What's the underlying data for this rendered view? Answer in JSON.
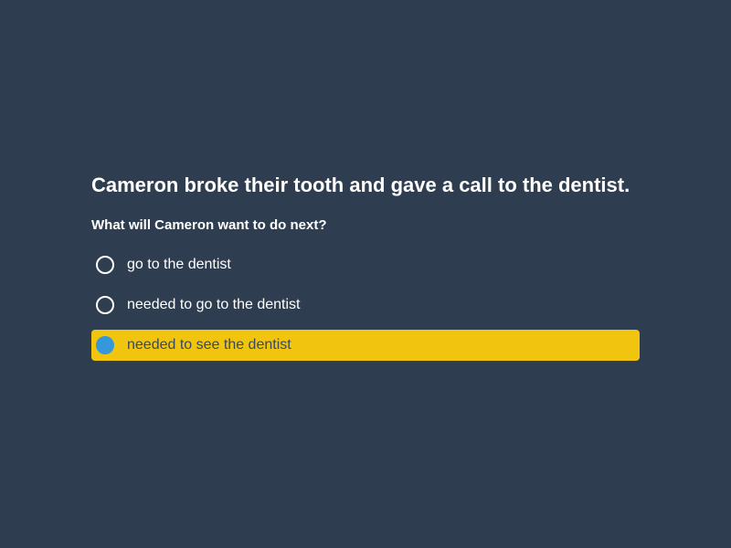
{
  "quiz": {
    "title": "Cameron broke their tooth and gave a call to the dentist.",
    "question": "What will Cameron want to do next?",
    "options": [
      {
        "label": "go to the dentist",
        "selected": false
      },
      {
        "label": "needed to go to the dentist",
        "selected": false
      },
      {
        "label": "needed to see the dentist",
        "selected": true
      }
    ]
  },
  "colors": {
    "background": "#2e3e50",
    "selected_highlight": "#f1c40f",
    "selected_radio": "#3498db"
  }
}
